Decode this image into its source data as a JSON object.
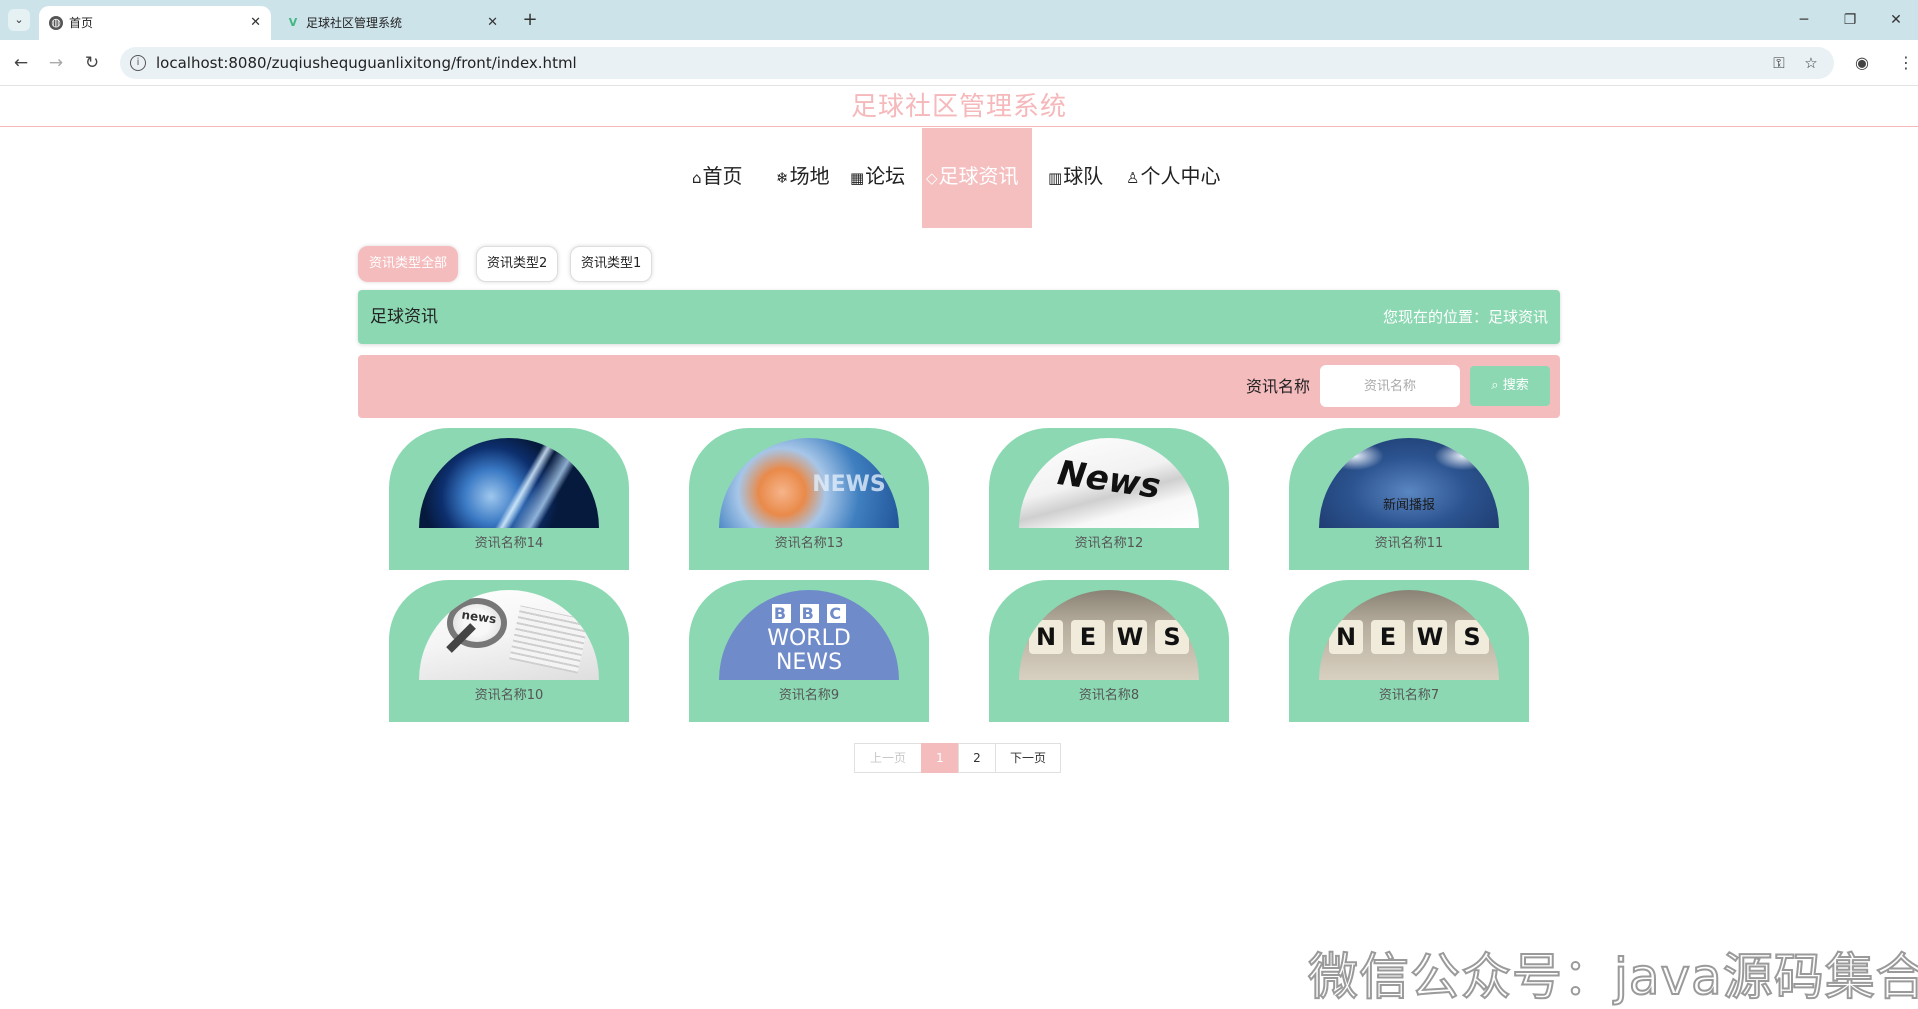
{
  "browser": {
    "tabs": [
      {
        "title": "首页",
        "active": true,
        "icon": "globe-icon"
      },
      {
        "title": "足球社区管理系统",
        "active": false,
        "icon": "vue-logo-icon"
      }
    ],
    "url": "localhost:8080/zuqiushequguanlixitong/front/index.html"
  },
  "site": {
    "title": "足球社区管理系统",
    "menu": [
      {
        "label": "首页",
        "icon": "home-icon",
        "active": false
      },
      {
        "label": "场地",
        "icon": "snowflake-icon",
        "active": false
      },
      {
        "label": "论坛",
        "icon": "calendar-icon",
        "active": false
      },
      {
        "label": "足球资讯",
        "icon": "tag-icon",
        "active": true
      },
      {
        "label": "球队",
        "icon": "grid-icon",
        "active": false
      },
      {
        "label": "个人中心",
        "icon": "user-icon",
        "active": false
      }
    ]
  },
  "filters": {
    "types": [
      "资讯类型全部",
      "资讯类型2",
      "资讯类型1"
    ],
    "active_index": 0
  },
  "breadcrumb": {
    "title": "足球资讯",
    "location": "您现在的位置：足球资讯"
  },
  "search": {
    "label": "资讯名称",
    "placeholder": "资讯名称",
    "button": "搜索"
  },
  "news": [
    {
      "name": "资讯名称14",
      "image": "globe-news-image"
    },
    {
      "name": "资讯名称13",
      "image": "news-studio-image"
    },
    {
      "name": "资讯名称12",
      "image": "newspaper-image"
    },
    {
      "name": "资讯名称11",
      "image": "news-broadcast-image",
      "image_text": "新闻播报"
    },
    {
      "name": "资讯名称10",
      "image": "magnifier-news-image",
      "image_text": "news"
    },
    {
      "name": "资讯名称9",
      "image": "bbc-world-news-image",
      "image_text": "BBC WORLD NEWS"
    },
    {
      "name": "资讯名称8",
      "image": "news-cubes-image",
      "image_text": "NEWS"
    },
    {
      "name": "资讯名称7",
      "image": "news-cubes-image",
      "image_text": "NEWS"
    }
  ],
  "pagination": {
    "prev": "上一页",
    "pages": [
      "1",
      "2"
    ],
    "current": "1",
    "next": "下一页"
  },
  "watermark": "微信公众号：java源码集合",
  "colors": {
    "pink": "#f5bcbe",
    "green": "#8cd8b3"
  }
}
